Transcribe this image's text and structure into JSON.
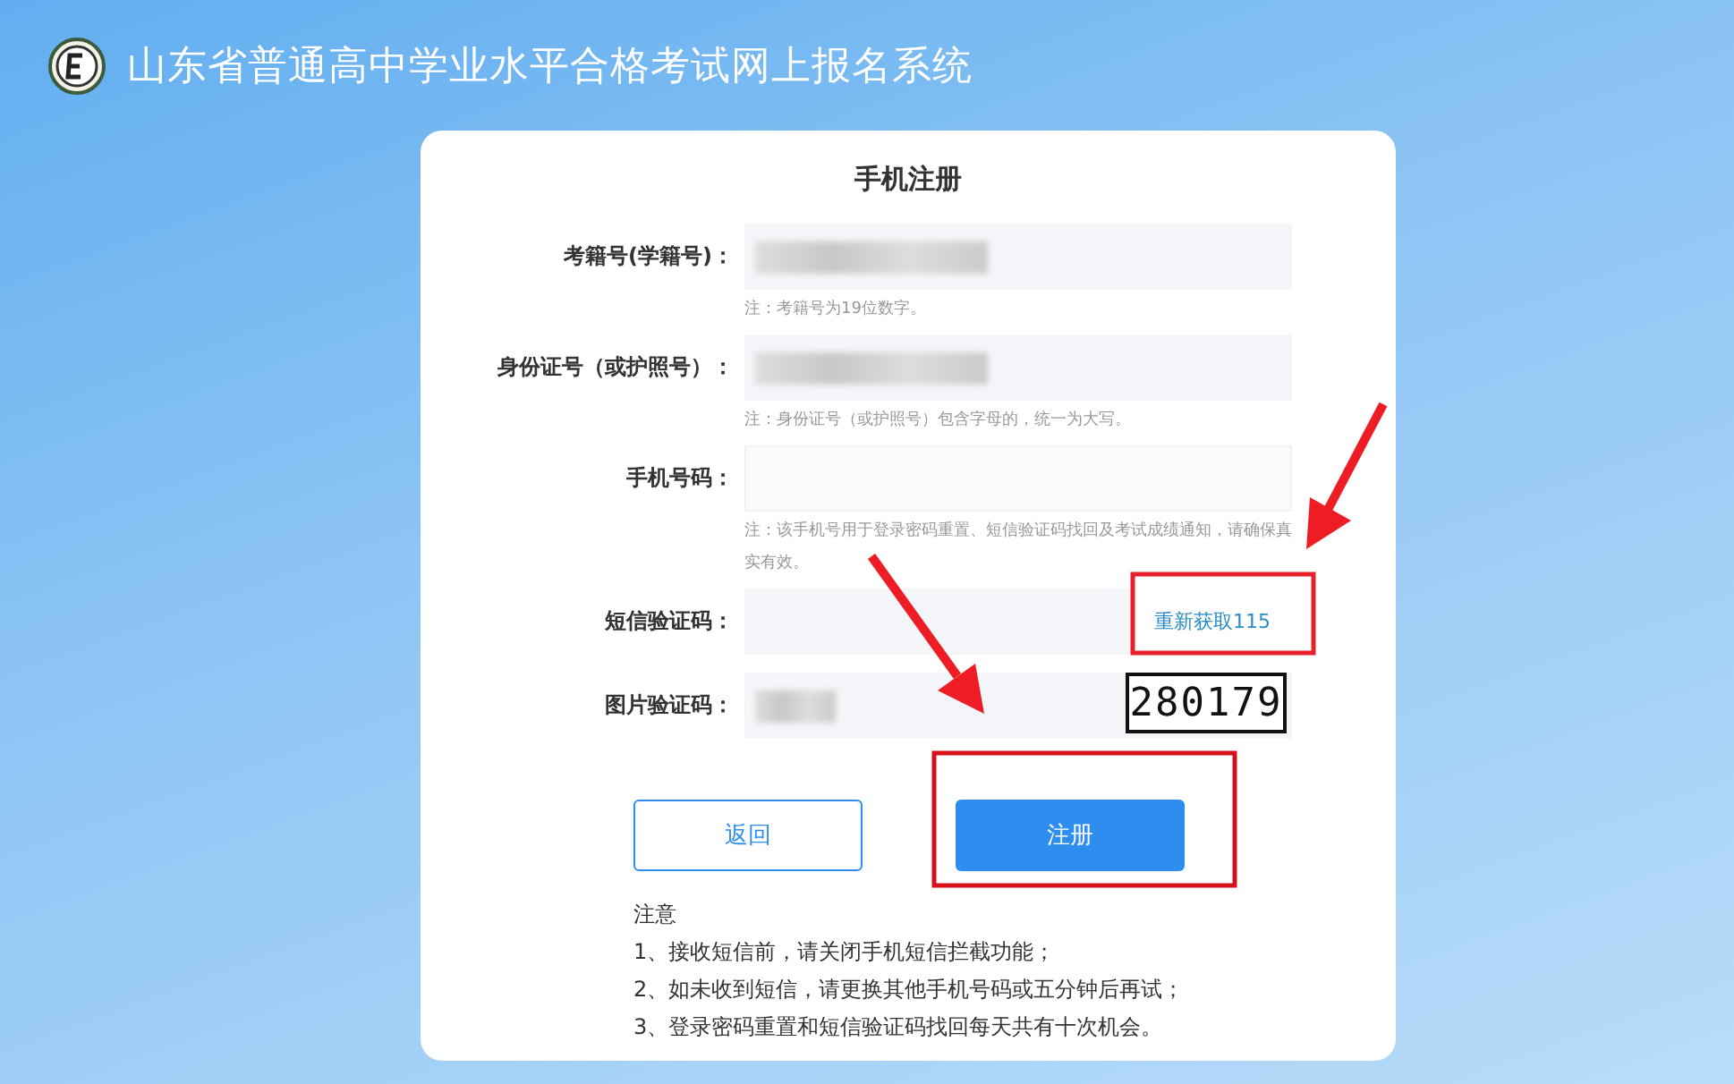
{
  "header": {
    "title": "山东省普通高中学业水平合格考试网上报名系统"
  },
  "form": {
    "title": "手机注册",
    "fields": [
      {
        "kind": "text",
        "label": "考籍号(学籍号)：",
        "value_obscured": true,
        "hint": "注：考籍号为19位数字。"
      },
      {
        "kind": "text",
        "label": "身份证号（或护照号）：",
        "value_obscured": true,
        "hint": "注：身份证号（或护照号）包含字母的，统一为大写。"
      },
      {
        "kind": "text",
        "label": "手机号码：",
        "value_obscured": false,
        "hint": "注：该手机号用于登录密码重置、短信验证码找回及考试成绩通知，请确保真实有效。"
      },
      {
        "kind": "sms",
        "label": "短信验证码：",
        "value_obscured": false,
        "action": "重新获取115"
      },
      {
        "kind": "captcha",
        "label": "图片验证码：",
        "value_obscured": true,
        "captcha_text": "280179"
      }
    ],
    "buttons": [
      {
        "kind": "secondary",
        "label": "返回"
      },
      {
        "kind": "primary",
        "label": "注册"
      }
    ],
    "notes": {
      "title": "注意",
      "items": [
        "1、接收短信前，请关闭手机短信拦截功能；",
        "2、如未收到短信，请更换其他手机号码或五分钟后再试；",
        "3、登录密码重置和短信验证码找回每天共有十次机会。"
      ]
    }
  }
}
